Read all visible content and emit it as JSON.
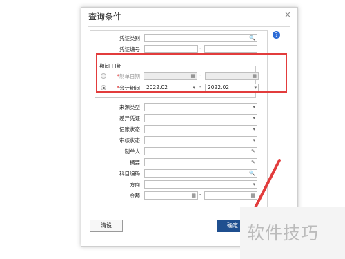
{
  "dialog": {
    "title": "查询条件",
    "close": "×",
    "help": "?"
  },
  "fields": {
    "voucher_type": {
      "label": "凭证类别",
      "value": ""
    },
    "voucher_no": {
      "label": "凭证编号",
      "from": "",
      "to": "",
      "separator": "-"
    },
    "period_group": {
      "legend": "期间  日期",
      "make_date": {
        "label": "*制单日期",
        "from": "",
        "to": "",
        "separator": "-"
      },
      "accounting_period": {
        "label": "*会计期间",
        "from": "2022.02",
        "to": "2022.02",
        "separator": "-"
      }
    },
    "source_type": {
      "label": "来源类型",
      "value": ""
    },
    "diff_voucher": {
      "label": "差异凭证",
      "value": ""
    },
    "posting_status": {
      "label": "记账状态",
      "value": ""
    },
    "review_status": {
      "label": "审核状态",
      "value": ""
    },
    "maker": {
      "label": "制单人",
      "value": ""
    },
    "summary": {
      "label": "摘要",
      "value": ""
    },
    "account_code": {
      "label": "科目编码",
      "value": ""
    },
    "direction": {
      "label": "方向",
      "value": ""
    },
    "amount": {
      "label": "金额",
      "from": "",
      "to": "",
      "separator": "-"
    }
  },
  "buttons": {
    "reset": "清设",
    "ok": "确定"
  },
  "watermark": {
    "text": "软件技巧"
  },
  "colors": {
    "highlight": "#e23c3c",
    "primary": "#1f4f8f"
  }
}
